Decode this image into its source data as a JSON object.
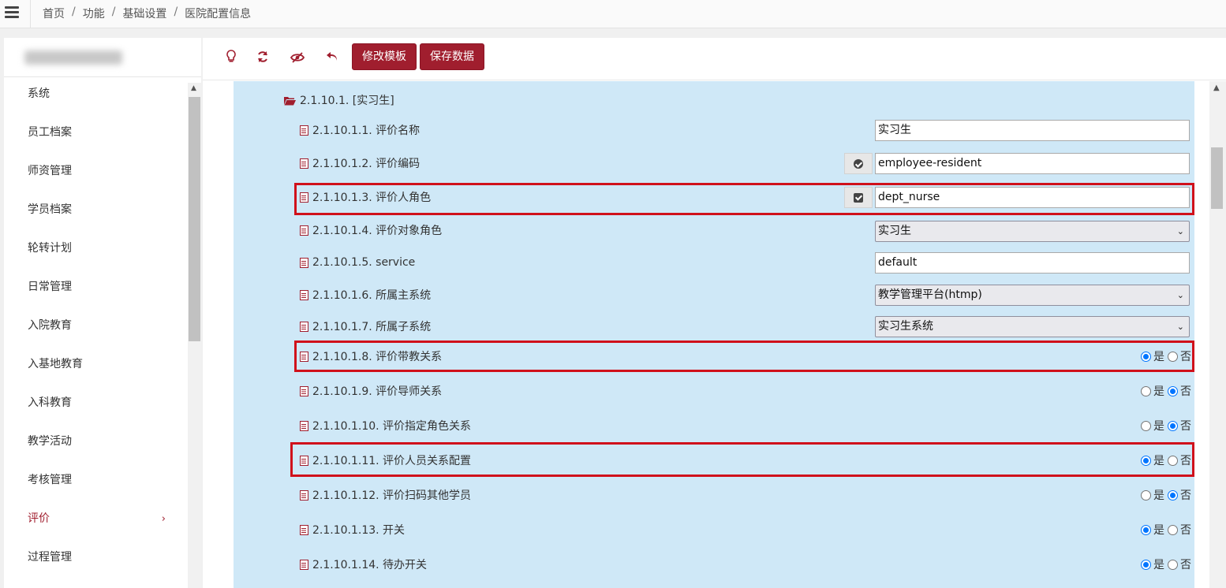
{
  "breadcrumb": [
    "首页",
    "功能",
    "基础设置",
    "医院配置信息"
  ],
  "breadcrumb_sep": "/",
  "sidebar": {
    "items": [
      {
        "label": "系统"
      },
      {
        "label": "员工档案"
      },
      {
        "label": "师资管理"
      },
      {
        "label": "学员档案"
      },
      {
        "label": "轮转计划"
      },
      {
        "label": "日常管理"
      },
      {
        "label": "入院教育"
      },
      {
        "label": "入基地教育"
      },
      {
        "label": "入科教育"
      },
      {
        "label": "教学活动"
      },
      {
        "label": "考核管理"
      },
      {
        "label": "评价",
        "active": true,
        "chevron": "›"
      },
      {
        "label": "过程管理"
      }
    ]
  },
  "toolbar": {
    "icons": [
      "lightbulb-icon",
      "refresh-icon",
      "eye-slash-icon",
      "undo-icon"
    ],
    "edit_template_label": "修改模板",
    "save_data_label": "保存数据"
  },
  "tree": {
    "folder_label": "2.1.10.1. [实习生]",
    "rows": [
      {
        "label": "2.1.10.1.1. 评价名称",
        "type": "text",
        "value": "实习生"
      },
      {
        "label": "2.1.10.1.2. 评价编码",
        "type": "text",
        "value": "employee-resident",
        "side": "ok-circle-icon"
      },
      {
        "label": "2.1.10.1.3. 评价人角色",
        "type": "text",
        "value": "dept_nurse",
        "side": "check-square-icon",
        "highlight": true
      },
      {
        "label": "2.1.10.1.4. 评价对象角色",
        "type": "select",
        "value": "实习生"
      },
      {
        "label": "2.1.10.1.5. service",
        "type": "text",
        "value": "default"
      },
      {
        "label": "2.1.10.1.6. 所属主系统",
        "type": "select",
        "value": "教学管理平台(htmp)"
      },
      {
        "label": "2.1.10.1.7. 所属子系统",
        "type": "select",
        "value": "实习生系统"
      },
      {
        "label": "2.1.10.1.8. 评价带教关系",
        "type": "radio",
        "yes": true,
        "highlight": true
      },
      {
        "label": "2.1.10.1.9. 评价导师关系",
        "type": "radio",
        "yes": false
      },
      {
        "label": "2.1.10.1.10. 评价指定角色关系",
        "type": "radio",
        "yes": false
      },
      {
        "label": "2.1.10.1.11. 评价人员关系配置",
        "type": "radio",
        "yes": true,
        "highlight": true
      },
      {
        "label": "2.1.10.1.12. 评价扫码其他学员",
        "type": "radio",
        "yes": false
      },
      {
        "label": "2.1.10.1.13. 开关",
        "type": "radio",
        "yes": true
      },
      {
        "label": "2.1.10.1.14. 待办开关",
        "type": "radio",
        "yes": true
      }
    ],
    "yes_label": "是",
    "no_label": "否"
  },
  "colors": {
    "accent": "#a01e2e",
    "content_bg": "#cfe8f7",
    "highlight": "#d0111b",
    "radio": "#0075ff"
  }
}
